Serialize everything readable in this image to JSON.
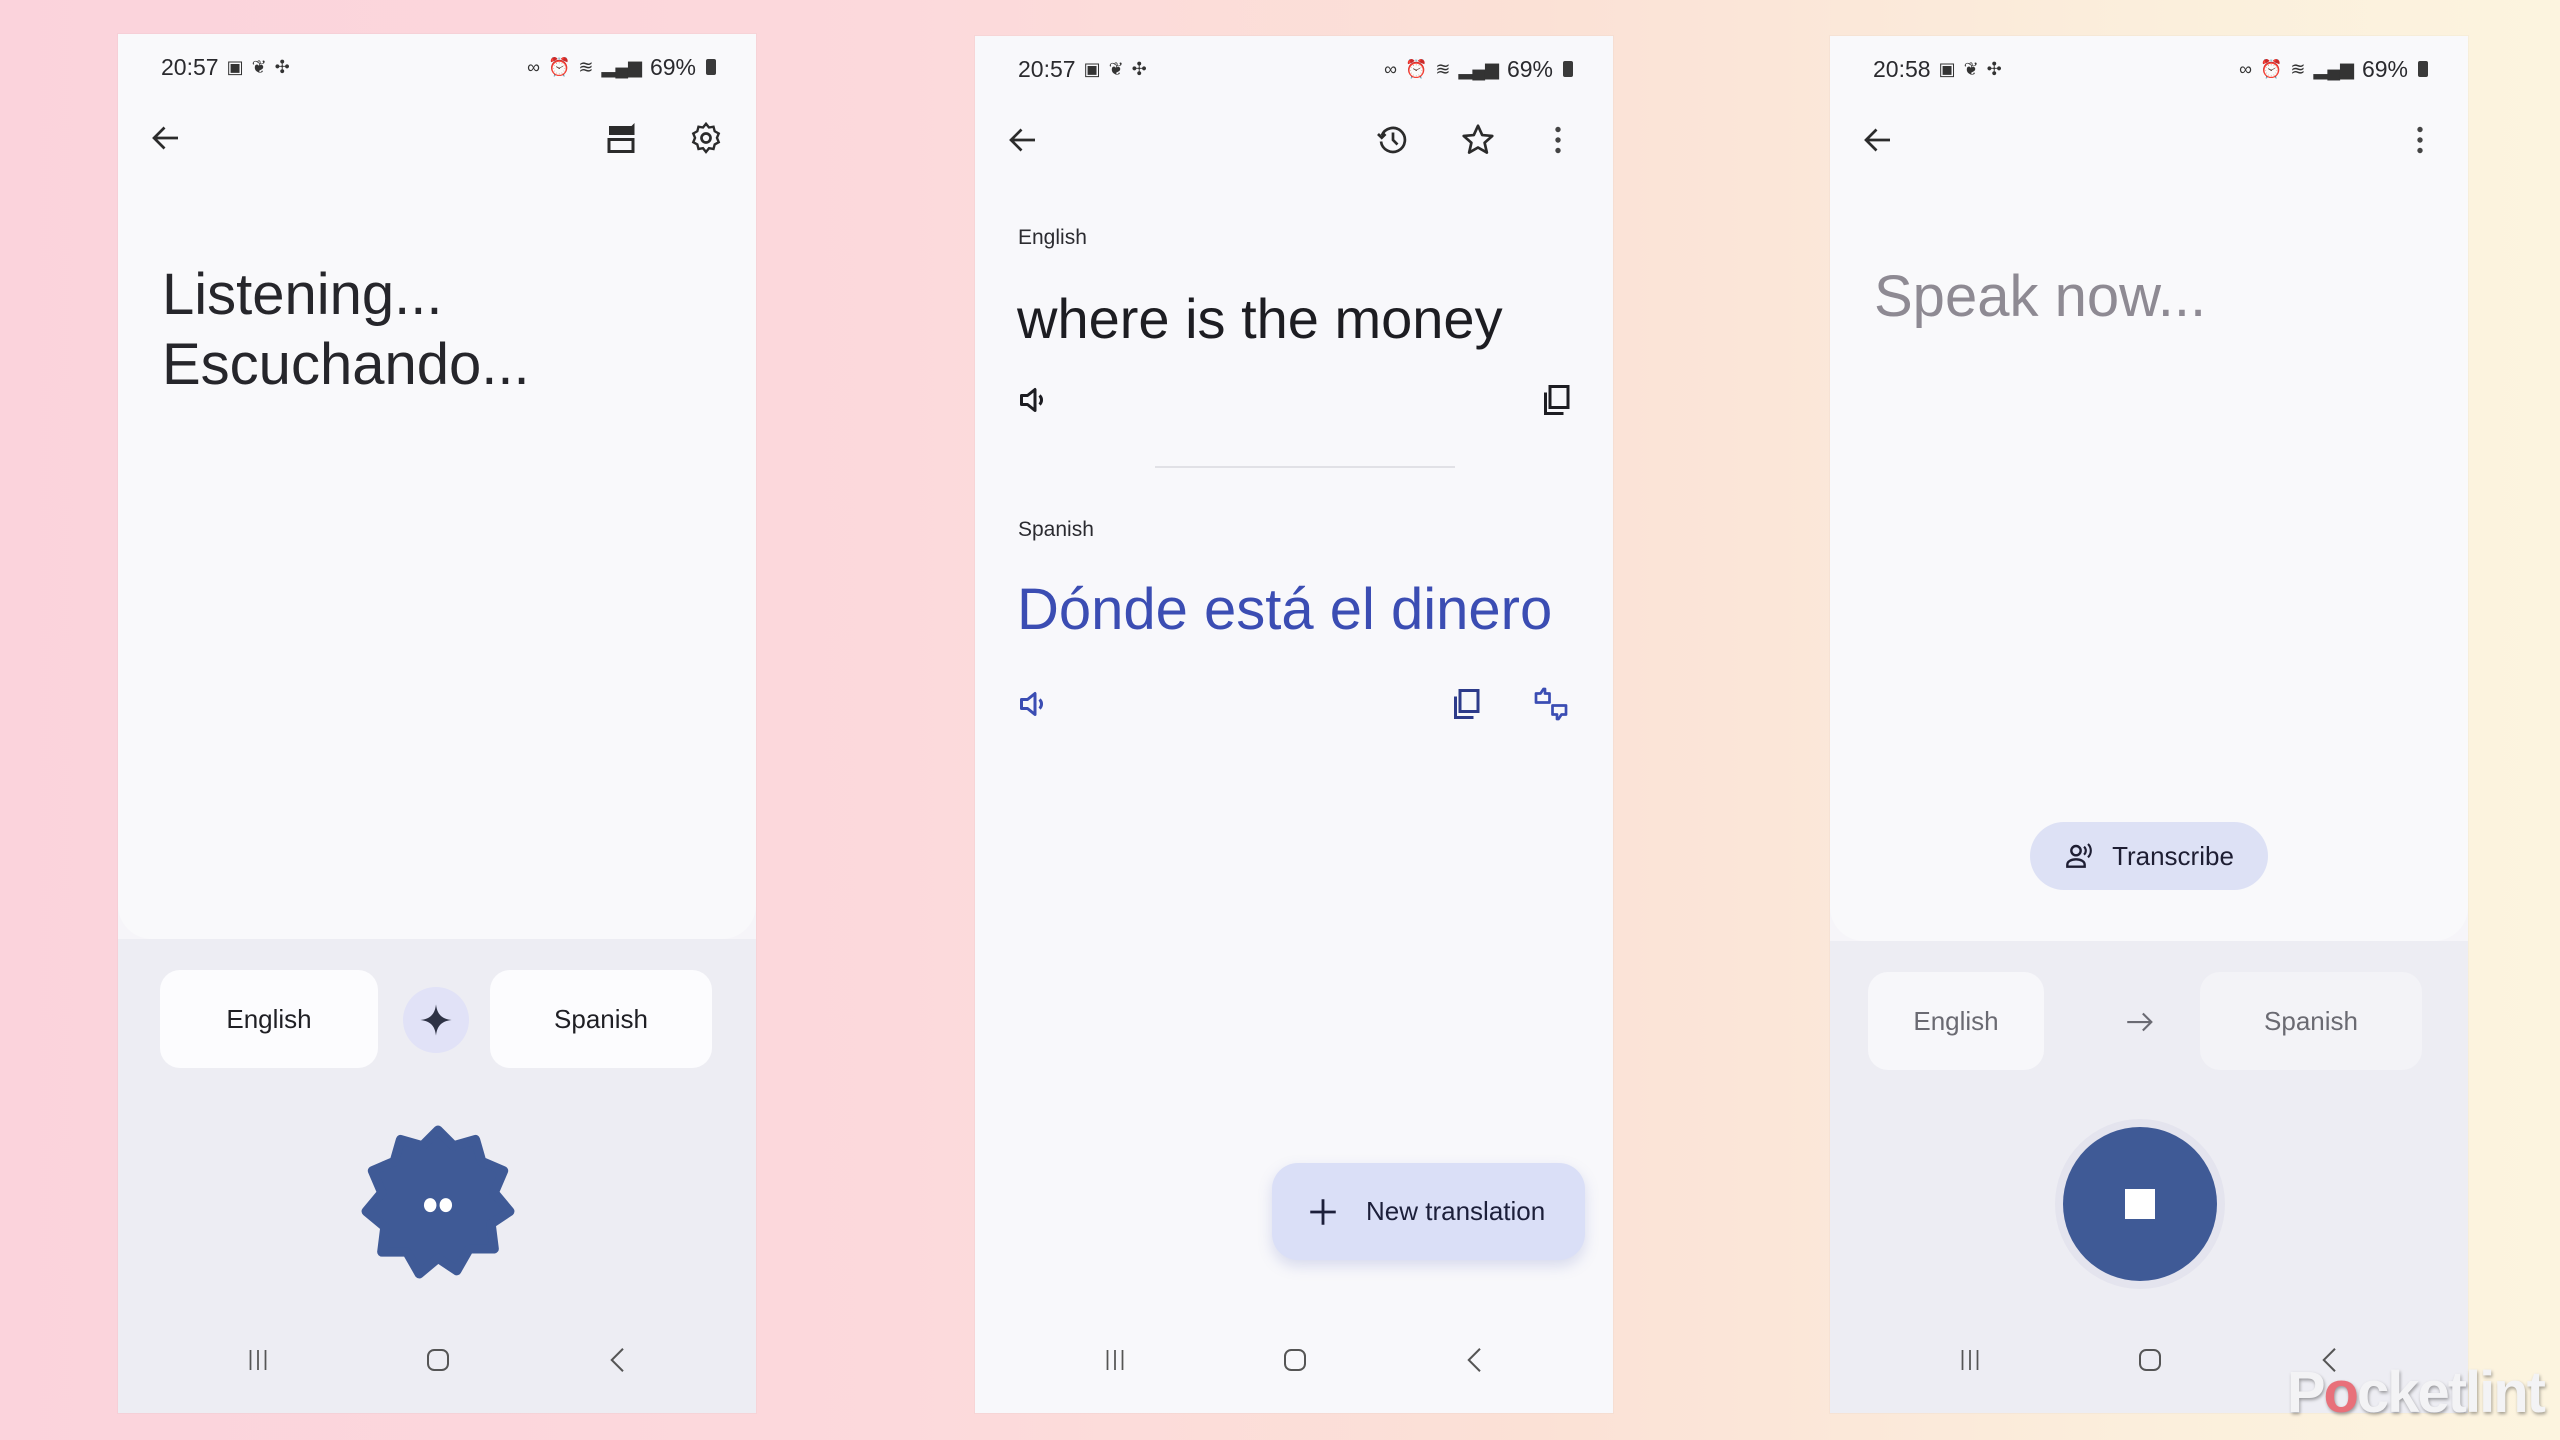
{
  "screens": [
    {
      "status": {
        "time": "20:57",
        "battery": "69%"
      },
      "toolbar": {
        "back": "back-arrow-icon",
        "actions": [
          "conversation-icon",
          "gear-icon"
        ]
      },
      "headline": [
        "Listening...",
        "Escuchando..."
      ],
      "languages": {
        "source": "English",
        "target": "Spanish",
        "middle_icon": "sparkle-icon"
      },
      "mic_state": "listening",
      "nav": [
        "recents",
        "home",
        "back"
      ]
    },
    {
      "status": {
        "time": "20:57",
        "battery": "69%"
      },
      "toolbar": {
        "back": "back-arrow-icon",
        "actions": [
          "history-icon",
          "star-icon",
          "more-vert-icon"
        ]
      },
      "source": {
        "language": "English",
        "text": "where is the money"
      },
      "target": {
        "language": "Spanish",
        "text": "Dónde está el dinero"
      },
      "fab_label": "New translation",
      "nav": [
        "recents",
        "home",
        "back"
      ]
    },
    {
      "status": {
        "time": "20:58",
        "battery": "69%"
      },
      "toolbar": {
        "back": "back-arrow-icon",
        "actions": [
          "more-vert-icon"
        ]
      },
      "headline": "Speak now...",
      "transcribe_label": "Transcribe",
      "languages": {
        "source": "English",
        "target": "Spanish",
        "middle_icon": "arrow-right-icon"
      },
      "mic_state": "recording",
      "nav": [
        "recents",
        "home",
        "back"
      ]
    }
  ],
  "colors": {
    "accent": "#3f5a96",
    "translation_text": "#3b4db3",
    "fab_bg": "#dadff7"
  },
  "watermark": {
    "pre": "P",
    "o": "o",
    "post": "cketlint"
  }
}
